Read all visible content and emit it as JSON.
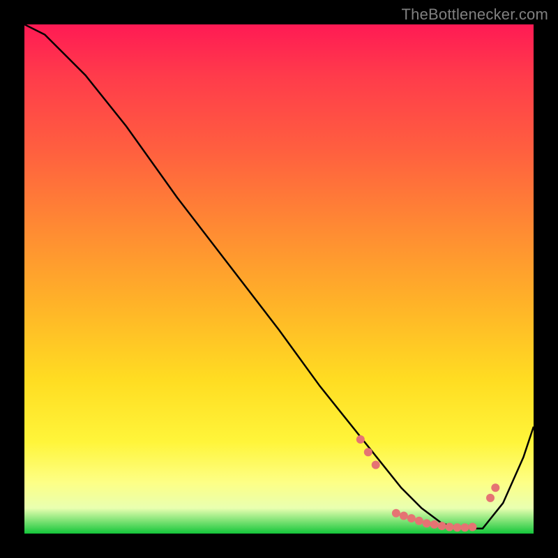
{
  "watermark": "TheBottlenecker.com",
  "chart_data": {
    "type": "line",
    "title": "",
    "xlabel": "",
    "ylabel": "",
    "xlim": [
      0,
      100
    ],
    "ylim": [
      0,
      100
    ],
    "grid": false,
    "legend": false,
    "series": [
      {
        "name": "bottleneck-curve",
        "x": [
          0,
          4,
          8,
          12,
          20,
          30,
          40,
          50,
          58,
          62,
          66,
          70,
          74,
          78,
          82,
          86,
          90,
          94,
          98,
          100
        ],
        "y": [
          100,
          98,
          94,
          90,
          80,
          66,
          53,
          40,
          29,
          24,
          19,
          14,
          9,
          5,
          2,
          1,
          1,
          6,
          15,
          21
        ]
      }
    ],
    "markers": {
      "name": "bottleneck-markers",
      "color": "#e57373",
      "points": [
        {
          "x": 66.0,
          "y": 18.5
        },
        {
          "x": 67.5,
          "y": 16.0
        },
        {
          "x": 69.0,
          "y": 13.5
        },
        {
          "x": 73.0,
          "y": 4.0
        },
        {
          "x": 74.5,
          "y": 3.5
        },
        {
          "x": 76.0,
          "y": 3.0
        },
        {
          "x": 77.5,
          "y": 2.5
        },
        {
          "x": 79.0,
          "y": 2.0
        },
        {
          "x": 80.5,
          "y": 1.8
        },
        {
          "x": 82.0,
          "y": 1.5
        },
        {
          "x": 83.5,
          "y": 1.3
        },
        {
          "x": 85.0,
          "y": 1.2
        },
        {
          "x": 86.5,
          "y": 1.2
        },
        {
          "x": 88.0,
          "y": 1.3
        },
        {
          "x": 91.5,
          "y": 7.0
        },
        {
          "x": 92.5,
          "y": 9.0
        }
      ]
    },
    "background_gradient": {
      "stops": [
        {
          "pct": 0,
          "color": "#ff1a54"
        },
        {
          "pct": 25,
          "color": "#ff603f"
        },
        {
          "pct": 55,
          "color": "#ffb328"
        },
        {
          "pct": 82,
          "color": "#fff53a"
        },
        {
          "pct": 95,
          "color": "#e9ffb0"
        },
        {
          "pct": 100,
          "color": "#14c63a"
        }
      ]
    }
  }
}
